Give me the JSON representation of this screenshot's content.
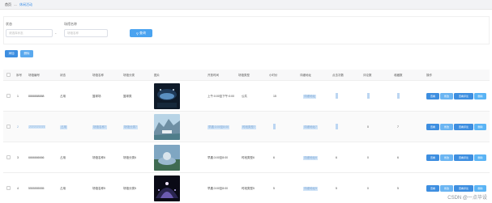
{
  "breadcrumb": {
    "home": "首页",
    "separator": "—",
    "current": "休闲活动"
  },
  "filters": {
    "status_label": "状态",
    "status_placeholder": "请选择状态",
    "name_label": "场馆名称",
    "name_placeholder": "场馆名称",
    "search_label": "查询"
  },
  "actions": {
    "add_label": "添加",
    "delete_label": "删除"
  },
  "table": {
    "headers": [
      "序号",
      "场馆编号",
      "状态",
      "场馆名称",
      "场馆分类",
      "图片",
      "开放时间",
      "场馆类型",
      "小时价",
      "详细地址",
      "点击次数",
      "评论数",
      "收藏数",
      "操作"
    ],
    "row_buttons": {
      "view": "查看",
      "edit": "修改",
      "comment": "查看评论",
      "delete": "删除"
    },
    "rows": [
      {
        "index": "1",
        "code": "8888888888",
        "status": "占用",
        "name": "篮球场",
        "category": "篮球类",
        "time": "上午:0:00至下午:0:00",
        "type": "公共",
        "price": "15",
        "address": "详细地址",
        "clicks": "",
        "comments": "",
        "favorites": ""
      },
      {
        "index": "2",
        "code": "7777777777",
        "status": "占用",
        "name": "场馆名称7",
        "category": "场馆分类7",
        "time": "早晨:3:00至8:00",
        "type": "时段类型7",
        "price": "",
        "address": "详细地址7",
        "clicks": "",
        "comments": "0",
        "favorites": "7"
      },
      {
        "index": "3",
        "code": "6666666666",
        "status": "占用",
        "name": "场馆名称6",
        "category": "场馆分类6",
        "time": "早晨:3:00至8:00",
        "type": "时段类型6",
        "price": "6",
        "address": "详细地址6",
        "clicks": "6",
        "comments": "0",
        "favorites": "6"
      },
      {
        "index": "4",
        "code": "5555555555",
        "status": "占用",
        "name": "场馆名称5",
        "category": "场馆分类5",
        "time": "早晨:3:00至8:00",
        "type": "时段类型5",
        "price": "5",
        "address": "详细地址5",
        "clicks": "5",
        "comments": "0",
        "favorites": "5"
      }
    ]
  },
  "watermark": "CSDN @一点毕设",
  "colors": {
    "primary": "#3d8ee0",
    "light": "#6bb5f2",
    "breadcrumb_current": "#3a8ee6"
  }
}
